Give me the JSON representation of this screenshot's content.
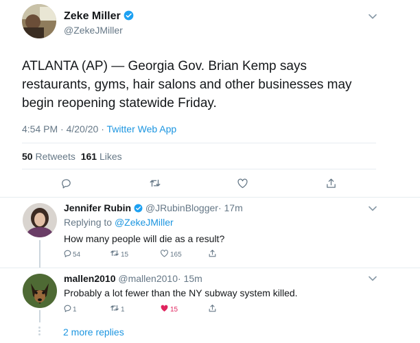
{
  "main_tweet": {
    "name": "Zeke Miller",
    "handle": "@ZekeJMiller",
    "text": "ATLANTA (AP) — Georgia Gov. Brian Kemp says restaurants, gyms, hair salons and other businesses may begin reopening statewide Friday.",
    "time": "4:54 PM · 4/20/20",
    "sep": "·",
    "source": "Twitter Web App",
    "retweets_count": "50",
    "retweets_label": "Retweets",
    "likes_count": "161",
    "likes_label": "Likes",
    "actions": [
      "reply-icon",
      "retweet-icon",
      "like-icon",
      "share-icon"
    ]
  },
  "replies": [
    {
      "name": "Jennifer Rubin",
      "handle": "@JRubinBlogger",
      "time": "· 17m",
      "replying_label": "Replying to",
      "replying_to": "@ZekeJMiller",
      "text": "How many people will die as a result?",
      "reply_count": "54",
      "retweet_count": "15",
      "like_count": "165",
      "liked": false
    },
    {
      "name": "mallen2010",
      "handle": "@mallen2010",
      "time": "· 15m",
      "text": "Probably a lot fewer than the NY subway system killed.",
      "reply_count": "1",
      "retweet_count": "1",
      "like_count": "15",
      "liked": true
    }
  ],
  "more_replies": "2 more replies",
  "colors": {
    "link": "#1b95e0",
    "muted": "#657786",
    "liked": "#e0245e",
    "divider": "#e6ecf0"
  }
}
